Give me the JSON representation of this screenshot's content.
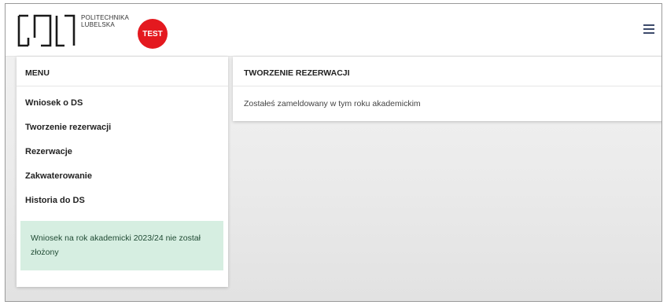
{
  "header": {
    "logo_line1": "POLITECHNIKA",
    "logo_line2": "LUBELSKA",
    "badge": "TEST",
    "menu_icon": "hamburger-menu-icon"
  },
  "sidebar": {
    "title": "MENU",
    "items": [
      {
        "label": "Wniosek o DS"
      },
      {
        "label": "Tworzenie rezerwacji"
      },
      {
        "label": "Rezerwacje"
      },
      {
        "label": "Zakwaterowanie"
      },
      {
        "label": "Historia do DS"
      }
    ],
    "notice": "Wniosek na rok akademicki 2023/24 nie został złożony"
  },
  "main": {
    "title": "TWORZENIE REZERWACJI",
    "message": "Zostałeś zameldowany w tym roku akademickim"
  },
  "colors": {
    "badge_red": "#e4191f",
    "notice_bg": "#d6eee1",
    "notice_text": "#1f4a33",
    "hamburger": "#3c4a6b"
  }
}
